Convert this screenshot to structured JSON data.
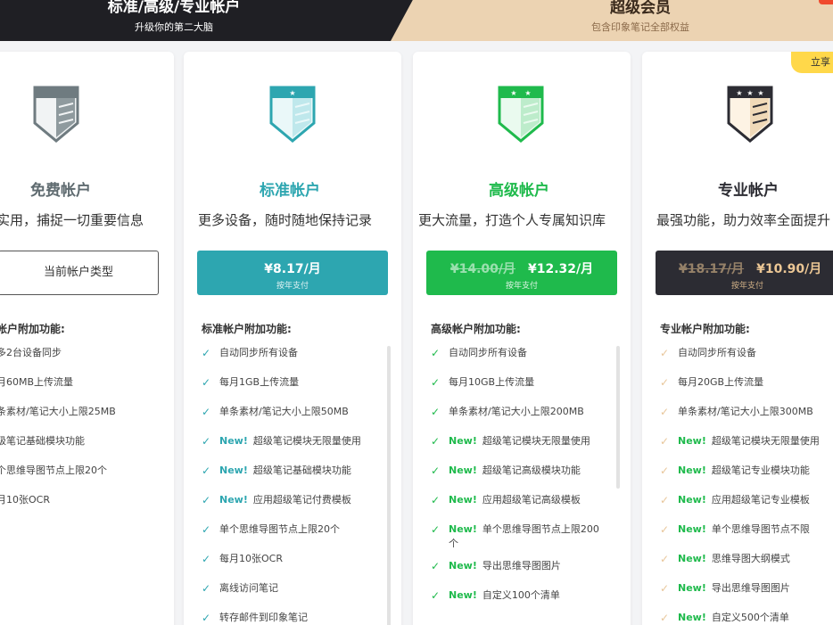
{
  "header": {
    "left_title": "标准/高级/专业帐户",
    "left_subtitle": "升级你的第二大脑",
    "right_title": "超级会员",
    "right_subtitle": "包含印象笔记全部权益"
  },
  "ribbon_label": "立享",
  "colors": {
    "free": "#6f7b80",
    "standard": "#2da6b0",
    "premium": "#1fba4c",
    "pro": "#2c2c33",
    "pro_check": "#e8c69a"
  },
  "plans": {
    "free": {
      "name": "免费帐户",
      "tagline": "实用，捕捉一切重要信息",
      "current_label": "当前帐户类型",
      "features_title": "帐户附加功能:",
      "features": [
        "多2台设备同步",
        "月60MB上传流量",
        "条素材/笔记大小上限25MB",
        "级笔记基础模块功能",
        "个思维导图节点上限20个",
        "月10张OCR"
      ]
    },
    "standard": {
      "name": "标准帐户",
      "tagline": "更多设备，随时随地保持记录",
      "price": "¥8.17/月",
      "price_note": "按年支付",
      "features_title": "标准帐户附加功能:",
      "new_label": "New!",
      "features": [
        {
          "new": false,
          "text": "自动同步所有设备"
        },
        {
          "new": false,
          "text": "每月1GB上传流量"
        },
        {
          "new": false,
          "text": "单条素材/笔记大小上限50MB"
        },
        {
          "new": true,
          "text": "超级笔记模块无限量使用"
        },
        {
          "new": true,
          "text": "超级笔记基础模块功能"
        },
        {
          "new": true,
          "text": "应用超级笔记付费模板"
        },
        {
          "new": false,
          "text": "单个思维导图节点上限20个"
        },
        {
          "new": false,
          "text": "每月10张OCR"
        },
        {
          "new": false,
          "text": "离线访问笔记"
        },
        {
          "new": false,
          "text": "转存邮件到印象笔记"
        }
      ]
    },
    "premium": {
      "name": "高级帐户",
      "tagline": "更大流量，打造个人专属知识库",
      "old_price": "¥14.00/月",
      "price": "¥12.32/月",
      "price_note": "按年支付",
      "features_title": "高级帐户附加功能:",
      "new_label": "New!",
      "features": [
        {
          "new": false,
          "text": "自动同步所有设备"
        },
        {
          "new": false,
          "text": "每月10GB上传流量"
        },
        {
          "new": false,
          "text": "单条素材/笔记大小上限200MB"
        },
        {
          "new": true,
          "text": "超级笔记模块无限量使用"
        },
        {
          "new": true,
          "text": "超级笔记高级模块功能"
        },
        {
          "new": true,
          "text": "应用超级笔记高级模板"
        },
        {
          "new": true,
          "text": "单个思维导图节点上限200个"
        },
        {
          "new": true,
          "text": "导出思维导图图片"
        },
        {
          "new": true,
          "text": "自定义100个清单"
        }
      ]
    },
    "pro": {
      "name": "专业帐户",
      "tagline": "最强功能，助力效率全面提升",
      "old_price": "¥18.17/月",
      "price": "¥10.90/月",
      "price_note": "按年支付",
      "features_title": "专业帐户附加功能:",
      "new_label": "New!",
      "features": [
        {
          "new": false,
          "text": "自动同步所有设备"
        },
        {
          "new": false,
          "text": "每月20GB上传流量"
        },
        {
          "new": false,
          "text": "单条素材/笔记大小上限300MB"
        },
        {
          "new": true,
          "text": "超级笔记模块无限量使用"
        },
        {
          "new": true,
          "text": "超级笔记专业模块功能"
        },
        {
          "new": true,
          "text": "应用超级笔记专业模板"
        },
        {
          "new": true,
          "text": "单个思维导图节点不限"
        },
        {
          "new": true,
          "text": "思维导图大纲模式"
        },
        {
          "new": true,
          "text": "导出思维导图图片"
        },
        {
          "new": true,
          "text": "自定义500个清单"
        }
      ]
    }
  }
}
